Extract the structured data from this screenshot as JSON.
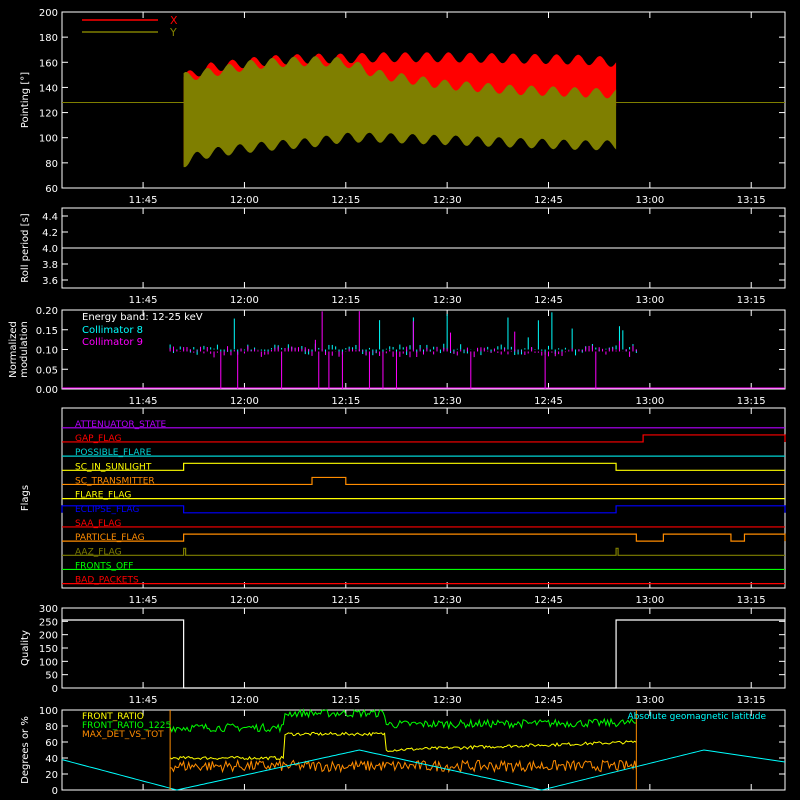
{
  "chart_data": [
    {
      "id": "pointing",
      "type": "area",
      "ylabel": "Pointing [°]",
      "ylim": [
        60,
        200
      ],
      "yticks": [
        60,
        80,
        100,
        120,
        140,
        160,
        180,
        200
      ],
      "x_range": [
        "11:33",
        "13:20"
      ],
      "xticks": [
        "11:45",
        "12:00",
        "12:15",
        "12:30",
        "12:45",
        "13:00",
        "13:15"
      ],
      "legend": "top-left",
      "baseline": 128,
      "series": [
        {
          "name": "X",
          "color": "#ff0000",
          "x": [
            "11:51",
            "11:53",
            "11:55",
            "11:58",
            "12:01",
            "12:05",
            "12:10",
            "12:15",
            "12:20",
            "12:30",
            "12:40",
            "12:50",
            "12:55"
          ],
          "upper": [
            148,
            152,
            156,
            158,
            160,
            162,
            163,
            163,
            164,
            164,
            163,
            162,
            160
          ],
          "lower": [
            78,
            95,
            104,
            110,
            114,
            118,
            122,
            124,
            124,
            124,
            124,
            125,
            125
          ]
        },
        {
          "name": "Y",
          "color": "#7f7f00",
          "x": [
            "11:51",
            "11:53",
            "11:55",
            "11:58",
            "12:01",
            "12:05",
            "12:10",
            "12:15",
            "12:20",
            "12:30",
            "12:40",
            "12:50",
            "12:55"
          ],
          "upper": [
            148,
            150,
            152,
            155,
            158,
            160,
            161,
            160,
            150,
            142,
            138,
            136,
            135
          ],
          "lower": [
            80,
            85,
            88,
            90,
            92,
            94,
            96,
            100,
            100,
            98,
            96,
            94,
            94
          ]
        }
      ]
    },
    {
      "id": "roll",
      "type": "line",
      "ylabel": "Roll period [s]",
      "ylim": [
        3.5,
        4.5
      ],
      "yticks": [
        3.6,
        3.8,
        4.0,
        4.2,
        4.4
      ],
      "xticks": [
        "11:45",
        "12:00",
        "12:15",
        "12:30",
        "12:45",
        "13:00",
        "13:15"
      ],
      "series": [
        {
          "name": "",
          "color": "#ffffff",
          "x": [
            "11:33",
            "13:20"
          ],
          "y": [
            4.0,
            4.0
          ]
        }
      ]
    },
    {
      "id": "modulation",
      "type": "line",
      "ylabel": "Normalized modulation",
      "ylim": [
        0,
        0.2
      ],
      "yticks": [
        0,
        0.05,
        0.1,
        0.15,
        0.2
      ],
      "xticks": [
        "11:45",
        "12:00",
        "12:15",
        "12:30",
        "12:45",
        "13:00",
        "13:15"
      ],
      "annotation": "Energy band: 12-25 keV",
      "series": [
        {
          "name": "Collimator 8",
          "color": "#00ffff",
          "active": [
            "11:49",
            "12:58"
          ],
          "level": 0.1
        },
        {
          "name": "Collimator 9",
          "color": "#ff00ff",
          "active": [
            "11:49",
            "12:58"
          ],
          "level": 0.095
        }
      ]
    },
    {
      "id": "flags",
      "type": "line",
      "ylabel": "Flags",
      "xticks": [
        "11:45",
        "12:00",
        "12:15",
        "12:30",
        "12:45",
        "13:00",
        "13:15"
      ],
      "series": [
        {
          "name": "ATTENUATOR_STATE",
          "color": "#b400ff",
          "steps": []
        },
        {
          "name": "GAP_FLAG",
          "color": "#ff0000",
          "steps": [
            [
              "12:59",
              "13:20"
            ]
          ]
        },
        {
          "name": "POSSIBLE_FLARE",
          "color": "#00d2d2",
          "steps": []
        },
        {
          "name": "SC_IN_SUNLIGHT",
          "color": "#ffff00",
          "steps": [
            [
              "11:51",
              "12:55"
            ]
          ]
        },
        {
          "name": "SC_TRANSMITTER",
          "color": "#ff8c00",
          "steps": [
            [
              "12:10",
              "12:15"
            ]
          ]
        },
        {
          "name": "FLARE_FLAG",
          "color": "#ffff00",
          "steps": []
        },
        {
          "name": "ECLIPSE_FLAG",
          "color": "#0000ff",
          "steps": [
            [
              "11:33",
              "11:51"
            ],
            [
              "12:55",
              "13:20"
            ]
          ]
        },
        {
          "name": "SAA_FLAG",
          "color": "#ff0000",
          "steps": []
        },
        {
          "name": "PARTICLE_FLAG",
          "color": "#ff8c00",
          "steps": [
            [
              "11:51",
              "12:58"
            ],
            [
              "13:02",
              "13:12"
            ],
            [
              "13:14",
              "13:20"
            ]
          ]
        },
        {
          "name": "AAZ_FLAG",
          "color": "#7f7f00",
          "steps": [
            [
              "11:51",
              "11:51"
            ],
            [
              "12:55",
              "12:55"
            ]
          ]
        },
        {
          "name": "FRONTS_OFF",
          "color": "#00ff00",
          "steps": []
        },
        {
          "name": "BAD_PACKETS",
          "color": "#ff0000",
          "steps": []
        }
      ]
    },
    {
      "id": "quality",
      "type": "line",
      "ylabel": "Quality",
      "ylim": [
        0,
        300
      ],
      "yticks": [
        0,
        50,
        100,
        150,
        200,
        250,
        300
      ],
      "xticks": [
        "11:45",
        "12:00",
        "12:15",
        "12:30",
        "12:45",
        "13:00",
        "13:15"
      ],
      "series": [
        {
          "name": "",
          "color": "#ffffff",
          "x": [
            "11:33",
            "11:51",
            "11:51",
            "12:55",
            "12:55",
            "13:20"
          ],
          "y": [
            255,
            255,
            0,
            0,
            255,
            255
          ]
        }
      ]
    },
    {
      "id": "ratios",
      "type": "line",
      "ylabel": "Degrees or %",
      "ylim": [
        0,
        100
      ],
      "yticks": [
        0,
        20,
        40,
        60,
        80,
        100
      ],
      "xticks": [
        "11:45",
        "12:00",
        "12:15",
        "12:30",
        "12:45",
        "13:00",
        "13:15"
      ],
      "series": [
        {
          "name": "FRONT_RATIO",
          "color": "#ffff00",
          "x": [
            "11:49",
            "12:06",
            "12:06",
            "12:21",
            "12:21",
            "12:58"
          ],
          "y": [
            40,
            40,
            70,
            70,
            50,
            60
          ]
        },
        {
          "name": "FRONT_RATIO_1225",
          "color": "#00ff00",
          "x": [
            "11:49",
            "12:06",
            "12:06",
            "12:21",
            "12:21",
            "12:58"
          ],
          "y": [
            78,
            78,
            96,
            96,
            82,
            84
          ]
        },
        {
          "name": "MAX_DET_VS_TOT",
          "color": "#ff8c00",
          "x": [
            "11:49",
            "12:58"
          ],
          "y": [
            30,
            30
          ]
        },
        {
          "name": "Absolute geomagnetic latitude",
          "color": "#00ffff",
          "x": [
            "11:33",
            "11:50",
            "12:17",
            "12:44",
            "13:08",
            "13:20"
          ],
          "y": [
            38,
            0,
            50,
            0,
            50,
            35
          ]
        }
      ]
    }
  ]
}
